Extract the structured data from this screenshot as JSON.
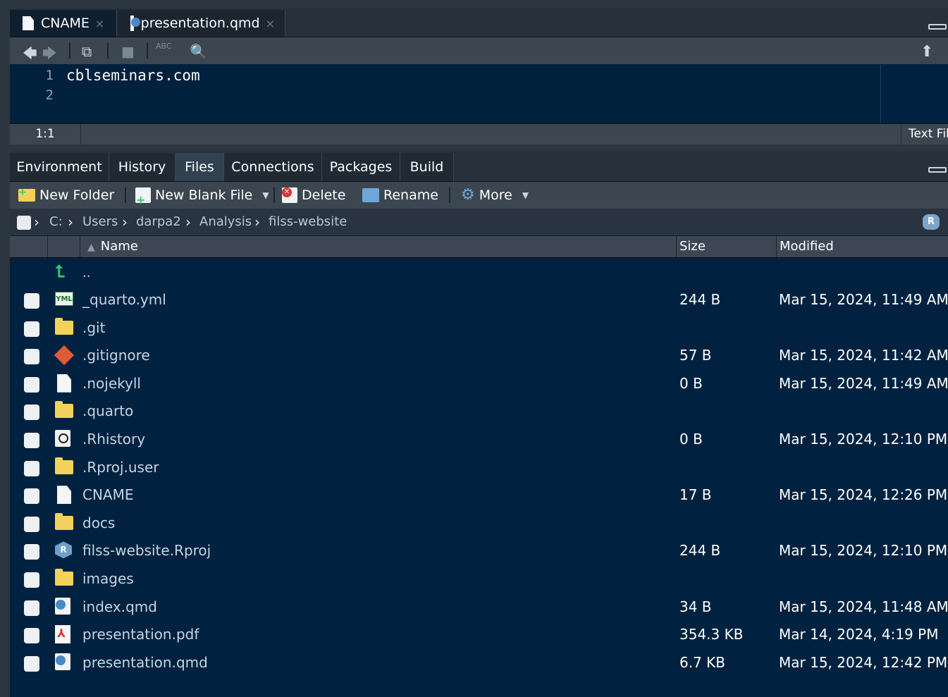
{
  "editor": {
    "tabs": [
      {
        "label": "CNAME",
        "icon": "file-icon"
      },
      {
        "label": "presentation.qmd",
        "icon": "quarto-file-icon"
      }
    ],
    "lines": [
      "1",
      "2"
    ],
    "code": "cblseminars.com",
    "cursor_pos": "1:1",
    "file_type": "Text File"
  },
  "files_pane": {
    "tabs": [
      "Environment",
      "History",
      "Files",
      "Connections",
      "Packages",
      "Build"
    ],
    "toolbar": {
      "new_folder": "New Folder",
      "new_blank_file": "New Blank File",
      "delete": "Delete",
      "rename": "Rename",
      "more": "More"
    },
    "breadcrumb": [
      "C:",
      "Users",
      "darpa2",
      "Analysis",
      "filss-website"
    ],
    "columns": {
      "name": "Name",
      "size": "Size",
      "modified": "Modified"
    },
    "parent": "..",
    "rows": [
      {
        "name": "_quarto.yml",
        "icon": "yml-file-icon",
        "size": "244 B",
        "modified": "Mar 15, 2024, 11:49 AM"
      },
      {
        "name": ".git",
        "icon": "folder-icon",
        "size": "",
        "modified": ""
      },
      {
        "name": ".gitignore",
        "icon": "git-icon",
        "size": "57 B",
        "modified": "Mar 15, 2024, 11:42 AM"
      },
      {
        "name": ".nojekyll",
        "icon": "file-icon",
        "size": "0 B",
        "modified": "Mar 15, 2024, 11:49 AM"
      },
      {
        "name": ".quarto",
        "icon": "folder-icon",
        "size": "",
        "modified": ""
      },
      {
        "name": ".Rhistory",
        "icon": "history-file-icon",
        "size": "0 B",
        "modified": "Mar 15, 2024, 12:10 PM"
      },
      {
        "name": ".Rproj.user",
        "icon": "folder-icon",
        "size": "",
        "modified": ""
      },
      {
        "name": "CNAME",
        "icon": "file-icon",
        "size": "17 B",
        "modified": "Mar 15, 2024, 12:26 PM"
      },
      {
        "name": "docs",
        "icon": "folder-icon",
        "size": "",
        "modified": ""
      },
      {
        "name": "filss-website.Rproj",
        "icon": "rproj-icon",
        "size": "244 B",
        "modified": "Mar 15, 2024, 12:10 PM"
      },
      {
        "name": "images",
        "icon": "folder-icon",
        "size": "",
        "modified": ""
      },
      {
        "name": "index.qmd",
        "icon": "quarto-file-icon",
        "size": "34 B",
        "modified": "Mar 15, 2024, 11:48 AM"
      },
      {
        "name": "presentation.pdf",
        "icon": "pdf-icon",
        "size": "354.3 KB",
        "modified": "Mar 14, 2024, 4:19 PM"
      },
      {
        "name": "presentation.qmd",
        "icon": "quarto-file-icon",
        "size": "6.7 KB",
        "modified": "Mar 15, 2024, 12:42 PM"
      }
    ]
  }
}
